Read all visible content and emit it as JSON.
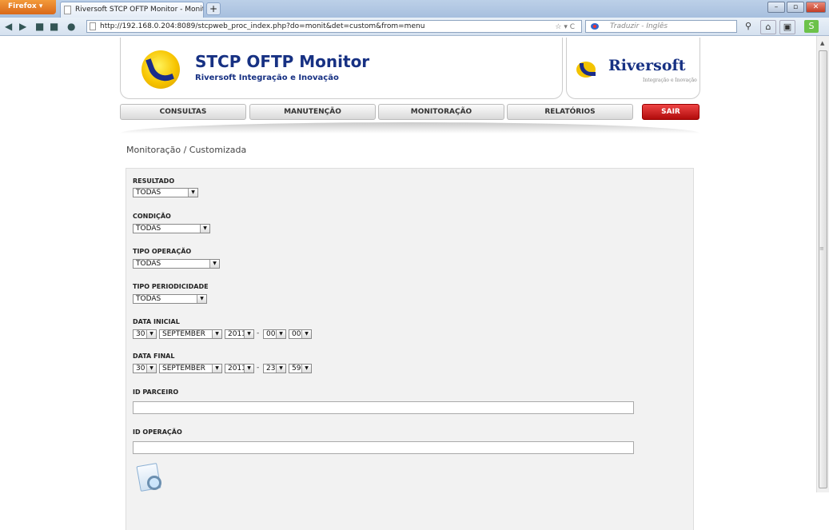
{
  "browser": {
    "app_button": "Firefox",
    "tab_title": "Riversoft STCP OFTP Monitor - Monitor...",
    "new_tab": "+",
    "url": "http://192.168.0.204:8089/stcpweb_proc_index.php?do=monit&det=custom&from=menu",
    "search_placeholder": "Traduzir - Inglês"
  },
  "header": {
    "title": "STCP OFTP Monitor",
    "subtitle": "Riversoft Integração e Inovação",
    "brand": "Riversoft",
    "brand_sub": "Integração e Inovação"
  },
  "menu": {
    "consultas": "CONSULTAS",
    "manutencao": "MANUTENÇÃO",
    "monitoracao": "MONITORAÇÃO",
    "relatorios": "RELATÓRIOS",
    "sair": "SAIR"
  },
  "breadcrumb": "Monitoração  /  Customizada",
  "form": {
    "resultado": {
      "label": "RESULTADO",
      "value": "TODAS"
    },
    "condicao": {
      "label": "CONDIÇÃO",
      "value": "TODAS"
    },
    "tipo_operacao": {
      "label": "TIPO OPERAÇÃO",
      "value": "TODAS"
    },
    "tipo_periodicidade": {
      "label": "TIPO PERIODICIDADE",
      "value": "TODAS"
    },
    "data_inicial": {
      "label": "DATA INICIAL",
      "day": "30",
      "month": "SEPTEMBER",
      "year": "2011",
      "hour": "00",
      "minute": "00"
    },
    "data_final": {
      "label": "DATA FINAL",
      "day": "30",
      "month": "SEPTEMBER",
      "year": "2011",
      "hour": "23",
      "minute": "59"
    },
    "id_parceiro": {
      "label": "ID PARCEIRO",
      "value": ""
    },
    "id_operacao": {
      "label": "ID OPERAÇÃO",
      "value": ""
    },
    "date_sep": "-"
  }
}
